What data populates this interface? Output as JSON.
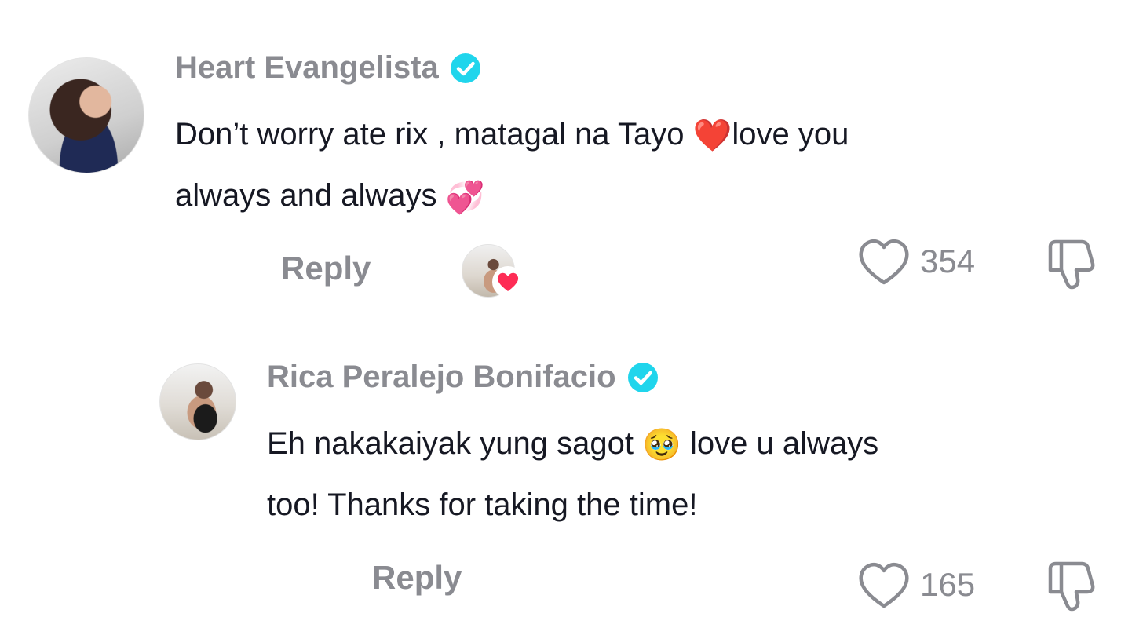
{
  "comments": [
    {
      "author": "Heart Evangelista",
      "verified": true,
      "text_line1_a": "Don’t worry ate rix , matagal na Tayo ",
      "text_line1_emoji": "❤️",
      "text_line1_b": "love you",
      "text_line2": "always and always ",
      "text_line2_emoji": "💞",
      "reply_label": "Reply",
      "liked_by_creator": true,
      "likes": "354"
    },
    {
      "author": "Rica Peralejo Bonifacio",
      "verified": true,
      "text_line1_a": "Eh nakakaiyak yung sagot ",
      "text_line1_emoji": "🥹",
      "text_line1_b": " love u always",
      "text_line2": "too! Thanks for taking the time!",
      "reply_label": "Reply",
      "likes": "165"
    }
  ],
  "colors": {
    "verified_badge": "#20d5ec",
    "muted_text": "#8a8b91",
    "body_text": "#161823",
    "heart_red": "#fe2c55"
  },
  "icons": [
    "verified-icon",
    "heart-outline-icon",
    "dislike-icon",
    "red-heart-icon"
  ]
}
